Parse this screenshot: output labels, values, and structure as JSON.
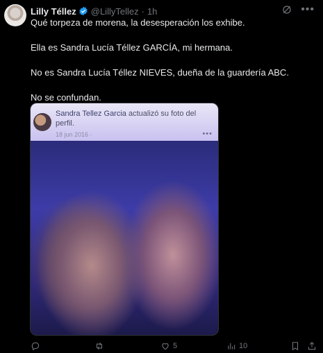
{
  "tweet": {
    "author_name": "Lilly Téllez",
    "handle": "@LillyTellez",
    "separator": "·",
    "time": "1h",
    "paragraphs": [
      "Qué torpeza de morena, la desesperación los exhibe.",
      "Ella es Sandra Lucía Téllez GARCÍA, mi hermana.",
      "No es Sandra Lucía Téllez NIEVES, dueña de la guardería ABC.",
      "No se confundan."
    ],
    "media": {
      "fb_name": "Sandra Tellez Garcia",
      "fb_action": " actualizó su foto del perfil.",
      "fb_date": "18 jun 2016 · ",
      "fb_more": "•••"
    },
    "actions": {
      "replies": "",
      "reposts": "",
      "likes": "5",
      "views": "10"
    }
  },
  "icons": {
    "verified": "verified-badge-icon",
    "grok": "grok-icon",
    "more": "more-icon",
    "reply": "reply-icon",
    "repost": "repost-icon",
    "like": "like-icon",
    "views": "views-icon",
    "bookmark": "bookmark-icon",
    "share": "share-icon"
  },
  "colors": {
    "background": "#000000",
    "text": "#e7e9ea",
    "muted": "#71767b",
    "verified": "#1d9bf0"
  }
}
